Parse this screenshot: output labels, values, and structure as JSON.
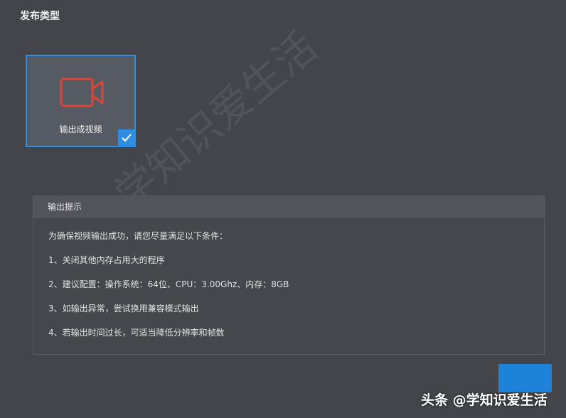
{
  "section": {
    "title": "发布类型"
  },
  "publish_types": [
    {
      "label": "输出成视频",
      "icon": "video-camera-icon",
      "selected": true
    }
  ],
  "tips": {
    "header": "输出提示",
    "lines": [
      "为确保视频输出成功，请您尽量满足以下条件：",
      "1、关闭其他内存占用大的程序",
      "2、建议配置：操作系统：64位、CPU：3.00Ghz、内存：8GB",
      "3、如输出异常，尝试换用兼容模式输出",
      "4、若输出时间过长，可适当降低分辨率和帧数"
    ]
  },
  "watermark": "学知识爱生活",
  "footer": {
    "credit": "头条 @学知识爱生活"
  },
  "colors": {
    "accent": "#2f8ee0",
    "icon_red": "#d9473a",
    "background": "#43454a"
  }
}
